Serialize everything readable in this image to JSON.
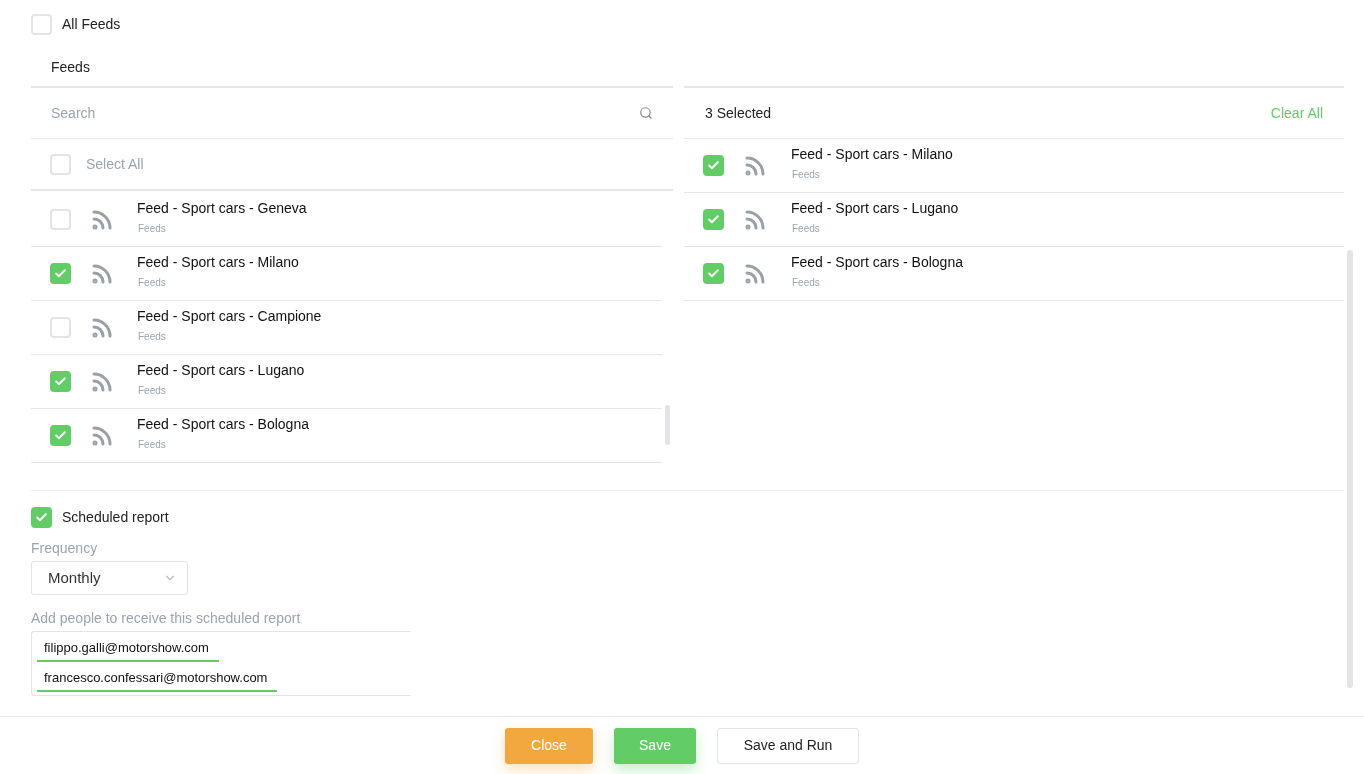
{
  "all_feeds": {
    "label": "All Feeds",
    "checked": false
  },
  "feeds_title": "Feeds",
  "search": {
    "placeholder": "Search"
  },
  "select_all": {
    "label": "Select All",
    "checked": false
  },
  "feeds": [
    {
      "name": "Feed - Sport cars - Geneva",
      "type": "Feeds",
      "checked": false
    },
    {
      "name": "Feed - Sport cars - Milano",
      "type": "Feeds",
      "checked": true
    },
    {
      "name": "Feed - Sport cars - Campione",
      "type": "Feeds",
      "checked": false
    },
    {
      "name": "Feed - Sport cars - Lugano",
      "type": "Feeds",
      "checked": true
    },
    {
      "name": "Feed - Sport cars - Bologna",
      "type": "Feeds",
      "checked": true
    }
  ],
  "selected_panel": {
    "count": "3 Selected",
    "clear": "Clear All",
    "items": [
      {
        "name": "Feed - Sport cars - Milano",
        "type": "Feeds",
        "checked": true
      },
      {
        "name": "Feed - Sport cars - Lugano",
        "type": "Feeds",
        "checked": true
      },
      {
        "name": "Feed - Sport cars - Bologna",
        "type": "Feeds",
        "checked": true
      }
    ]
  },
  "scheduled": {
    "label": "Scheduled report",
    "checked": true
  },
  "frequency": {
    "label": "Frequency",
    "value": "Monthly"
  },
  "recipients": {
    "label": "Add people to receive this scheduled report",
    "emails": [
      "filippo.galli@motorshow.com",
      "francesco.confessari@motorshow.com"
    ]
  },
  "buttons": [
    {
      "label": "Close",
      "kind": "close"
    },
    {
      "label": "Save",
      "kind": "save"
    },
    {
      "label": "Save and Run",
      "kind": "run"
    }
  ]
}
